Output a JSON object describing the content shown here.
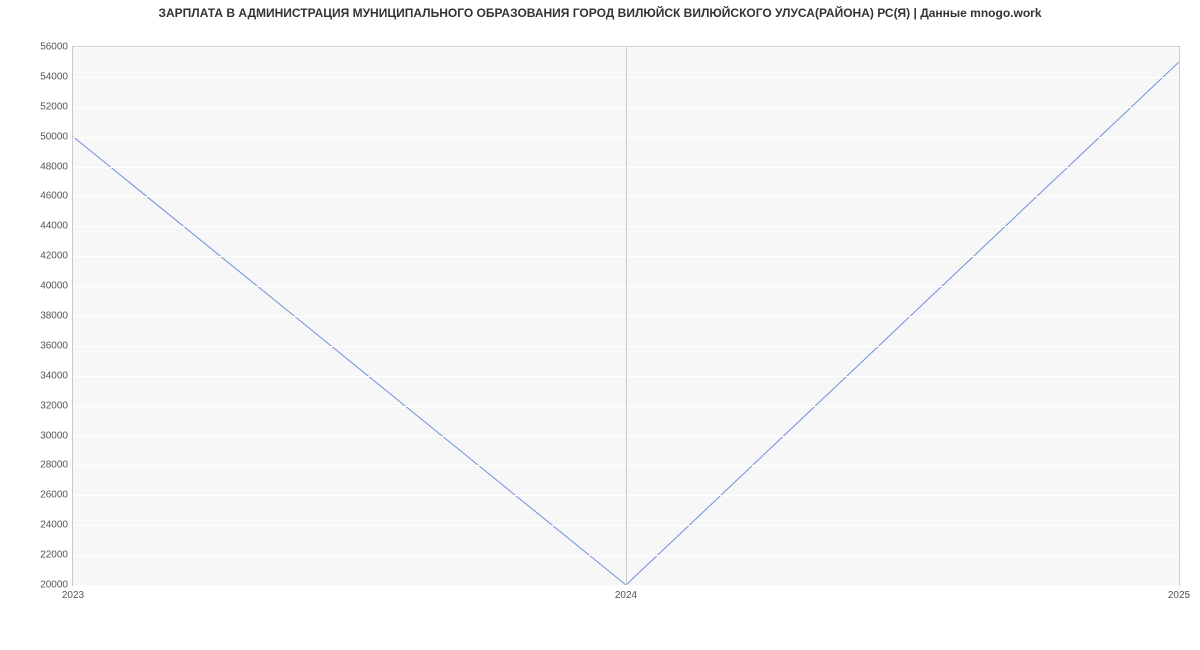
{
  "chart_data": {
    "type": "line",
    "title": "ЗАРПЛАТА В АДМИНИСТРАЦИЯ МУНИЦИПАЛЬНОГО ОБРАЗОВАНИЯ ГОРОД ВИЛЮЙСК ВИЛЮЙСКОГО УЛУСА(РАЙОНА) РС(Я) | Данные mnogo.work",
    "xlabel": "",
    "ylabel": "",
    "x": [
      2023,
      2024,
      2025
    ],
    "values": [
      50000,
      20000,
      55000
    ],
    "ylim": [
      20000,
      56000
    ],
    "xlim": [
      2023,
      2025
    ],
    "y_ticks": [
      20000,
      22000,
      24000,
      26000,
      28000,
      30000,
      32000,
      34000,
      36000,
      38000,
      40000,
      42000,
      44000,
      46000,
      48000,
      50000,
      52000,
      54000,
      56000
    ],
    "x_ticks": [
      2023,
      2024,
      2025
    ],
    "line_color": "#6f8fdc"
  }
}
